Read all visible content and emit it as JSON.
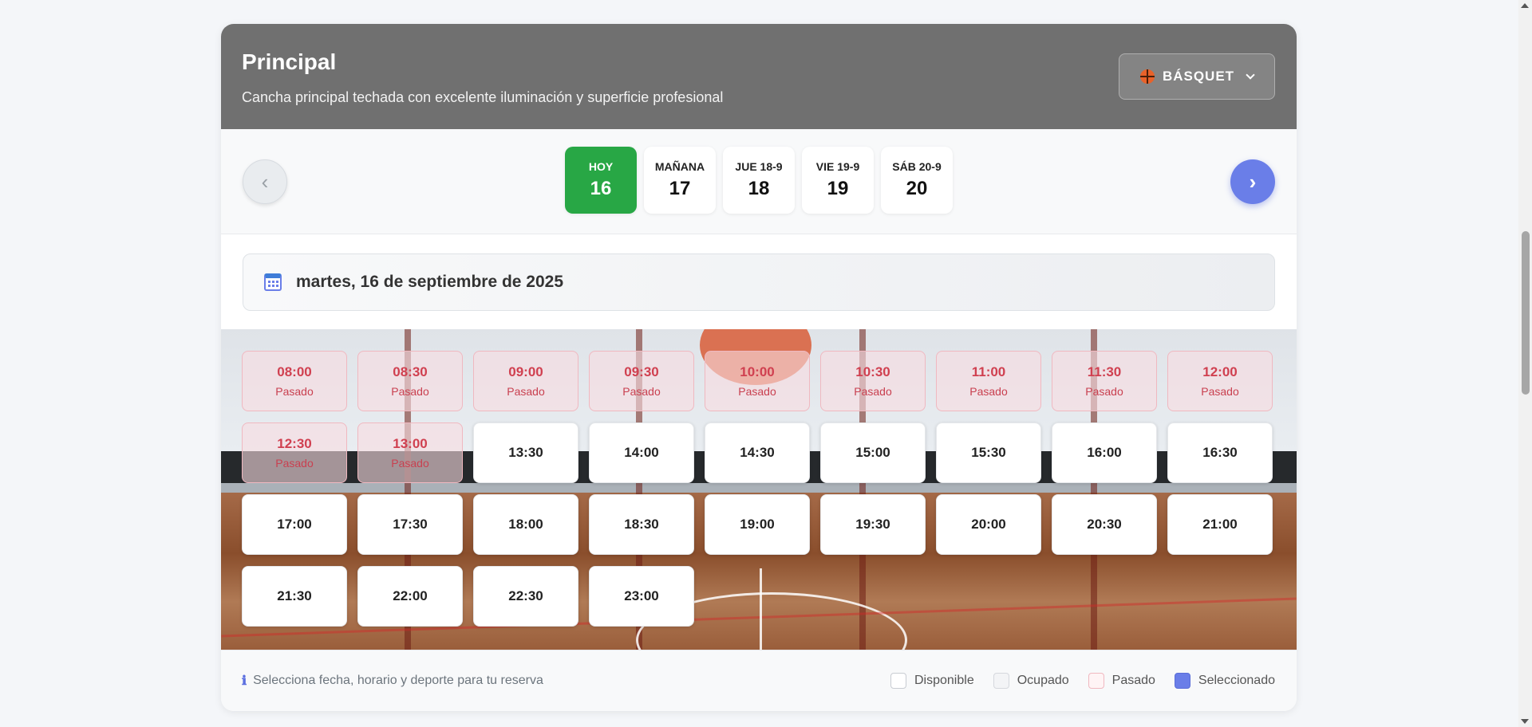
{
  "header": {
    "court_name": "Principal",
    "court_description": "Cancha principal techada con excelente iluminación y superficie profesional",
    "sport": {
      "label": "BÁSQUET",
      "icon": "basketball-icon"
    }
  },
  "date_nav": {
    "prev_symbol": "‹",
    "next_symbol": "›",
    "days": [
      {
        "label": "HOY",
        "number": "16",
        "active": true
      },
      {
        "label": "MAÑANA",
        "number": "17",
        "active": false
      },
      {
        "label": "JUE 18-9",
        "number": "18",
        "active": false
      },
      {
        "label": "VIE 19-9",
        "number": "19",
        "active": false
      },
      {
        "label": "SÁB 20-9",
        "number": "20",
        "active": false
      }
    ]
  },
  "selected_date": "martes, 16 de septiembre de 2025",
  "slots": [
    {
      "time": "08:00",
      "status": "Pasado"
    },
    {
      "time": "08:30",
      "status": "Pasado"
    },
    {
      "time": "09:00",
      "status": "Pasado"
    },
    {
      "time": "09:30",
      "status": "Pasado"
    },
    {
      "time": "10:00",
      "status": "Pasado"
    },
    {
      "time": "10:30",
      "status": "Pasado"
    },
    {
      "time": "11:00",
      "status": "Pasado"
    },
    {
      "time": "11:30",
      "status": "Pasado"
    },
    {
      "time": "12:00",
      "status": "Pasado"
    },
    {
      "time": "12:30",
      "status": "Pasado"
    },
    {
      "time": "13:00",
      "status": "Pasado"
    },
    {
      "time": "13:30",
      "status": ""
    },
    {
      "time": "14:00",
      "status": ""
    },
    {
      "time": "14:30",
      "status": ""
    },
    {
      "time": "15:00",
      "status": ""
    },
    {
      "time": "15:30",
      "status": ""
    },
    {
      "time": "16:00",
      "status": ""
    },
    {
      "time": "16:30",
      "status": ""
    },
    {
      "time": "17:00",
      "status": ""
    },
    {
      "time": "17:30",
      "status": ""
    },
    {
      "time": "18:00",
      "status": ""
    },
    {
      "time": "18:30",
      "status": ""
    },
    {
      "time": "19:00",
      "status": ""
    },
    {
      "time": "19:30",
      "status": ""
    },
    {
      "time": "20:00",
      "status": ""
    },
    {
      "time": "20:30",
      "status": ""
    },
    {
      "time": "21:00",
      "status": ""
    },
    {
      "time": "21:30",
      "status": ""
    },
    {
      "time": "22:00",
      "status": ""
    },
    {
      "time": "22:30",
      "status": ""
    },
    {
      "time": "23:00",
      "status": ""
    }
  ],
  "footer": {
    "hint": "Selecciona fecha, horario y deporte para tu reserva",
    "legend": {
      "available": "Disponible",
      "occupied": "Ocupado",
      "past": "Pasado",
      "selected": "Seleccionado"
    }
  },
  "colors": {
    "header_bg": "#707070",
    "today": "#28a745",
    "accent": "#6a7ee8",
    "past_text": "#d04050"
  }
}
